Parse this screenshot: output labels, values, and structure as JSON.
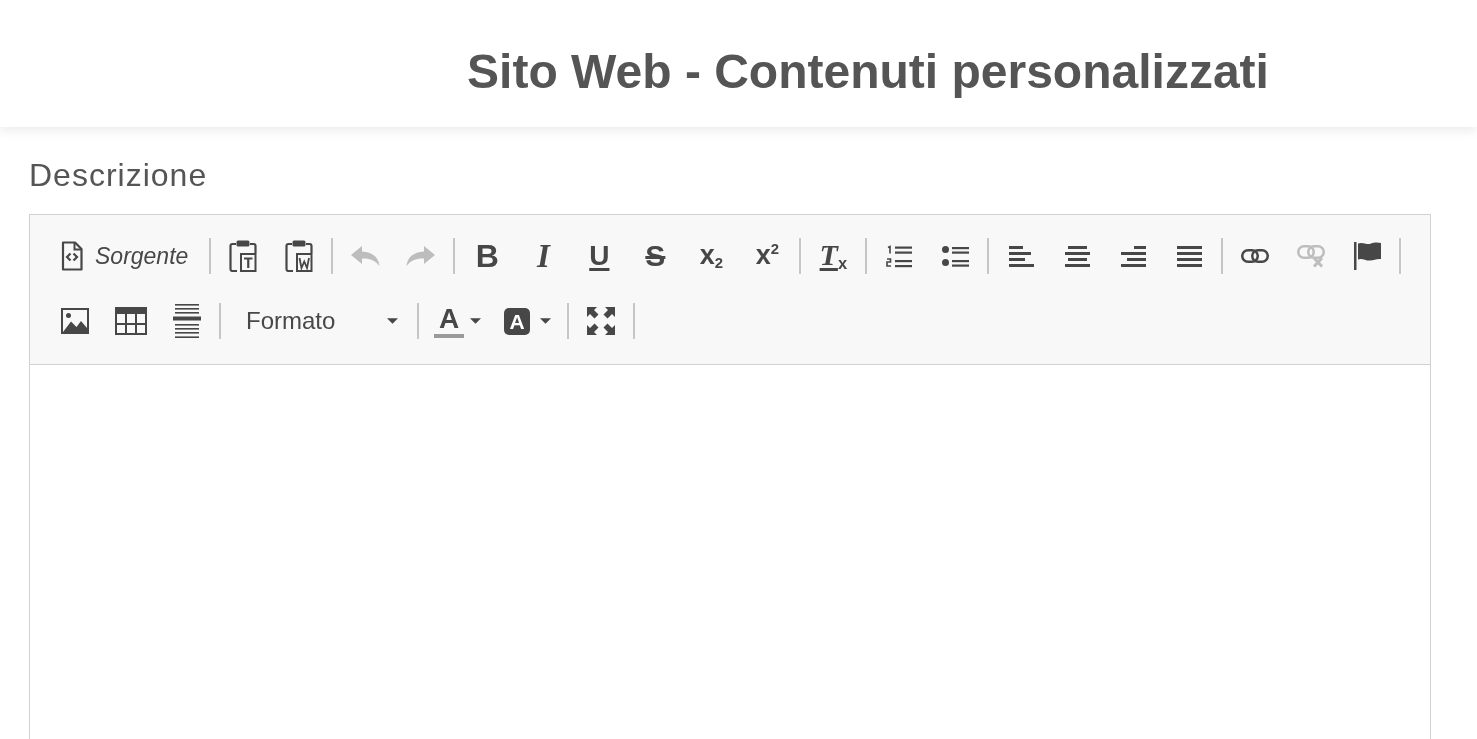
{
  "header": {
    "title": "Sito Web - Contenuti personalizzati"
  },
  "field": {
    "label": "Descrizione"
  },
  "editor": {
    "toolbar_rows": [
      {
        "groups": [
          {
            "items": [
              {
                "kind": "source",
                "label": "Sorgente",
                "disabled": false
              }
            ]
          },
          {
            "items": [
              {
                "kind": "pastetext",
                "disabled": false
              },
              {
                "kind": "pasteword",
                "disabled": false
              }
            ]
          },
          {
            "items": [
              {
                "kind": "undo",
                "disabled": true
              },
              {
                "kind": "redo",
                "disabled": true
              }
            ]
          },
          {
            "items": [
              {
                "kind": "bold",
                "glyph": "B",
                "disabled": false
              },
              {
                "kind": "italic",
                "glyph": "I",
                "disabled": false
              },
              {
                "kind": "underline",
                "glyph": "U",
                "disabled": false
              },
              {
                "kind": "strike",
                "glyph": "S",
                "disabled": false
              },
              {
                "kind": "subscript",
                "glyph": "x$_{2}$",
                "disabled": false
              },
              {
                "kind": "superscript",
                "glyph": "x$^{2}$",
                "disabled": false
              }
            ]
          },
          {
            "items": [
              {
                "kind": "removeformat",
                "glyph": "T$_{x}$",
                "disabled": false
              }
            ]
          },
          {
            "items": [
              {
                "kind": "numberedlist",
                "disabled": false
              },
              {
                "kind": "bulletedlist",
                "disabled": false
              }
            ]
          },
          {
            "items": [
              {
                "kind": "alignleft",
                "disabled": false
              },
              {
                "kind": "aligncenter",
                "disabled": false
              },
              {
                "kind": "alignright",
                "disabled": false
              },
              {
                "kind": "justify",
                "disabled": false
              }
            ]
          },
          {
            "items": [
              {
                "kind": "link",
                "disabled": false
              },
              {
                "kind": "unlink",
                "disabled": true
              },
              {
                "kind": "anchor",
                "disabled": false
              }
            ]
          }
        ]
      },
      {
        "groups": [
          {
            "items": [
              {
                "kind": "image",
                "disabled": false
              },
              {
                "kind": "table",
                "disabled": false
              },
              {
                "kind": "hrule",
                "disabled": false
              }
            ]
          },
          {
            "items": [
              {
                "kind": "format",
                "label": "Formato",
                "disabled": false
              }
            ]
          },
          {
            "items": [
              {
                "kind": "textcolor",
                "glyph": "A",
                "disabled": false
              },
              {
                "kind": "bgcolor",
                "glyph": "A",
                "disabled": false
              }
            ]
          },
          {
            "items": [
              {
                "kind": "maximize",
                "disabled": false
              }
            ]
          }
        ]
      }
    ]
  }
}
